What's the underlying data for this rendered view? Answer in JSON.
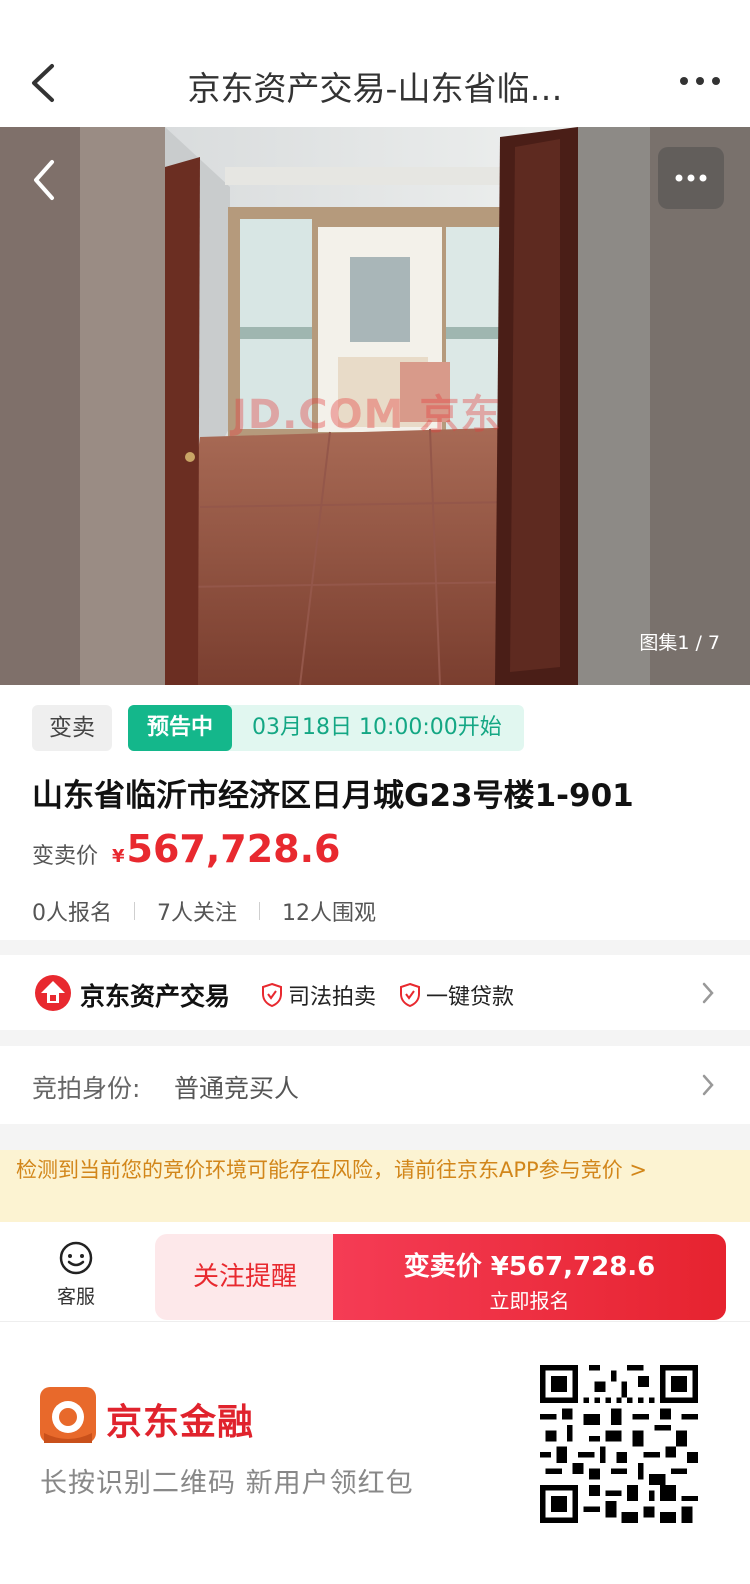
{
  "nav": {
    "title": "京东资产交易-山东省临…",
    "back_icon": "chevron-left-icon",
    "more_icon": "more-dots-icon"
  },
  "hero": {
    "image_counter": "图集1 / 7",
    "watermark": "JD.COM 京东"
  },
  "info": {
    "sale_type_tag": "变卖",
    "status_badge": "预告中",
    "status_time": "03月18日 10:00:00开始",
    "title": "山东省临沂市经济区日月城G23号楼1-901",
    "price_label": "变卖价",
    "price_currency": "¥",
    "price_value": "567,728.6",
    "stats": {
      "signups": "0人报名",
      "followers": "7人关注",
      "viewers": "12人围观"
    }
  },
  "platform": {
    "name": "京东资产交易",
    "feature_1": "司法拍卖",
    "feature_2": "一键贷款"
  },
  "identity": {
    "label": "竞拍身份:",
    "value": "普通竞买人"
  },
  "warning": {
    "text": "检测到当前您的竞价环境可能存在风险，请前往京东APP参与竞价 >"
  },
  "bottom_bar": {
    "service_label": "客服",
    "follow_label": "关注提醒",
    "register_main": "变卖价 ¥567,728.6",
    "register_sub": "立即报名"
  },
  "promo": {
    "brand": "京东金融",
    "text": "长按识别二维码 新用户领红包"
  },
  "colors": {
    "accent_red": "#e8292f",
    "status_green": "#14b78b",
    "warning_bg": "#fcf3d2",
    "warning_text": "#d2861a"
  }
}
